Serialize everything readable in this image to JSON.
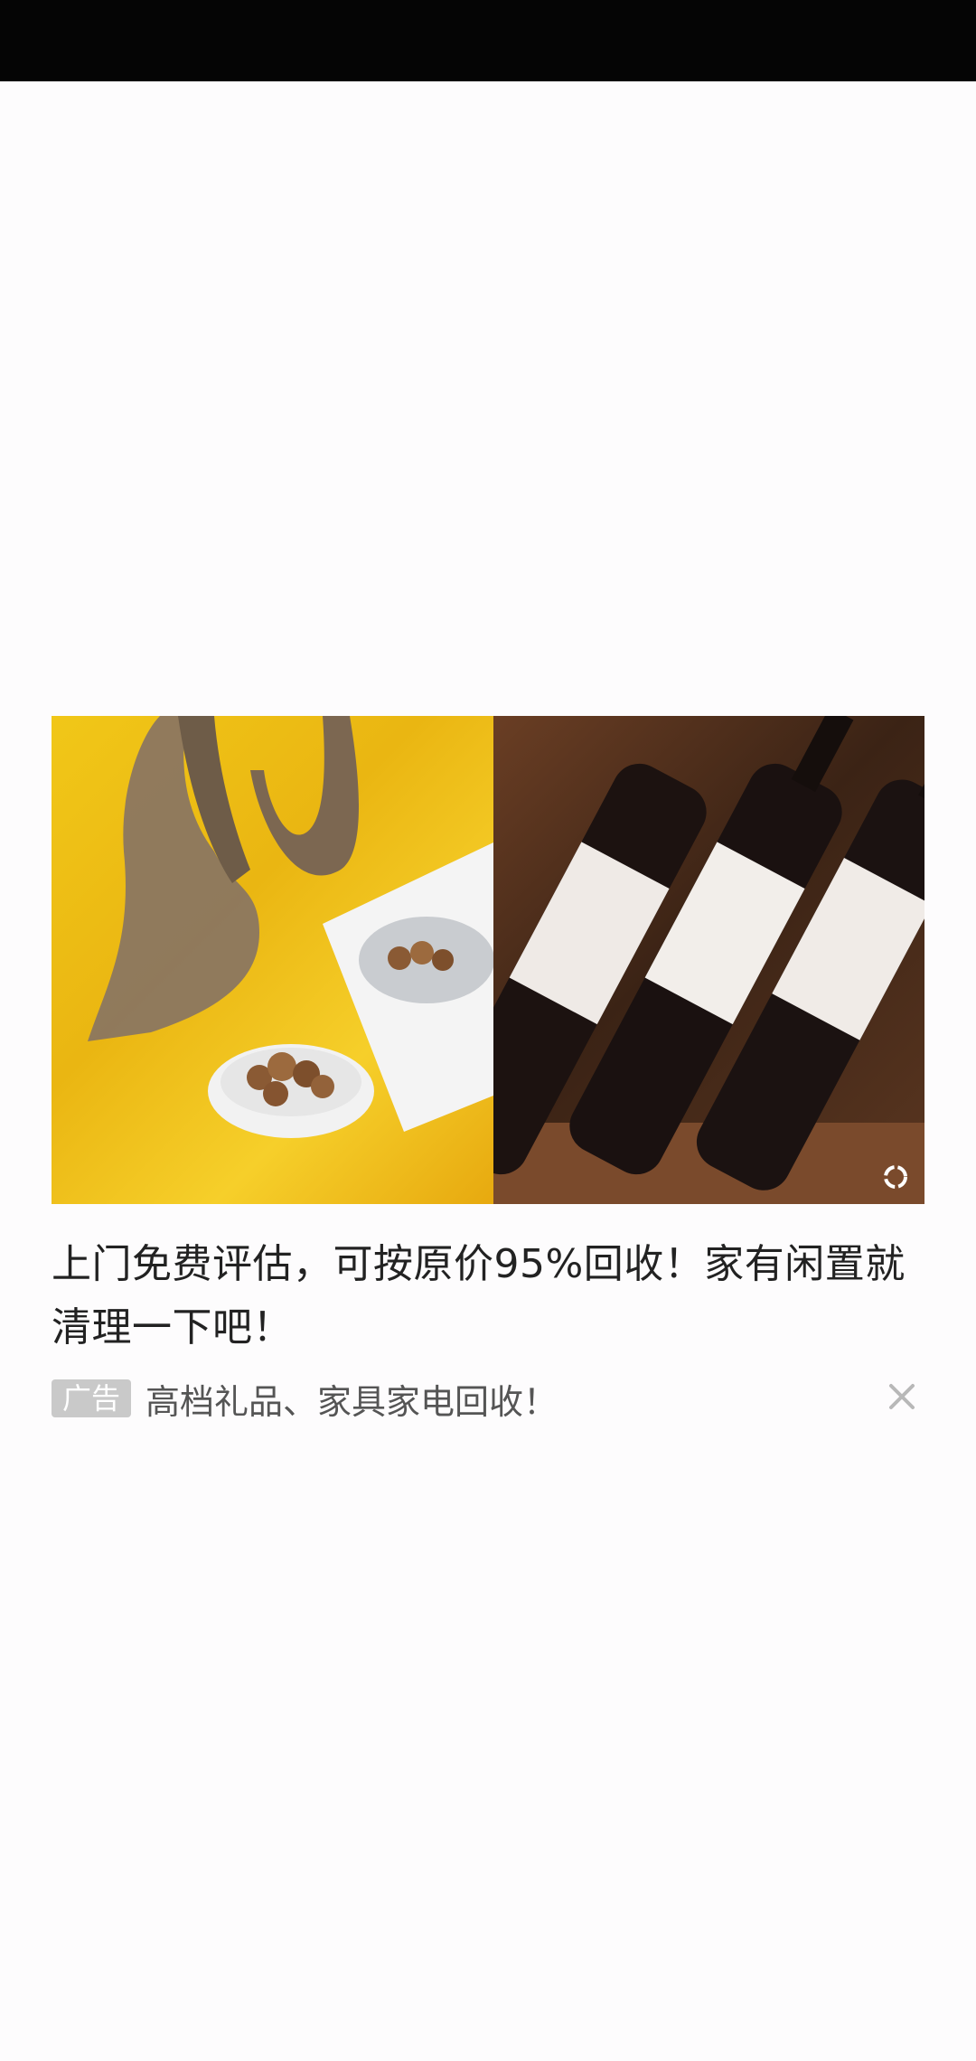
{
  "ad": {
    "title": "上门免费评估，可按原价95%回收！家有闲置就清理一下吧！",
    "badge": "广告",
    "subtitle": "高档礼品、家具家电回收！",
    "images": [
      "antler-and-mushrooms-photo",
      "wine-bottles-photo"
    ],
    "icons": {
      "refresh": "refresh-icon",
      "close": "close-icon"
    }
  },
  "colors": {
    "status_bar": "#050505",
    "background": "#fdfcfd",
    "badge_bg": "#c9c9c9",
    "title_text": "#222222",
    "subtitle_text": "#555555"
  }
}
